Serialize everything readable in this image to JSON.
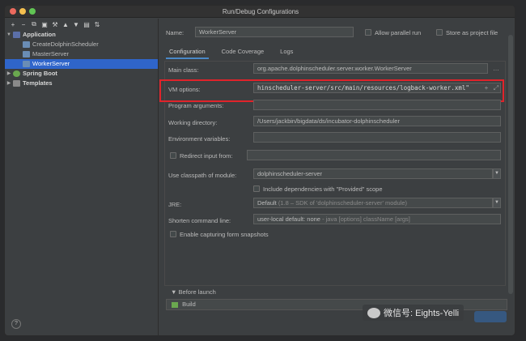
{
  "window": {
    "title": "Run/Debug Configurations"
  },
  "toolbar": {
    "icons": [
      "add-icon",
      "remove-icon",
      "copy-icon",
      "save-icon",
      "wrench-icon",
      "move-up-icon",
      "move-down-icon",
      "folder-icon",
      "sort-icon"
    ]
  },
  "tree": {
    "application": "Application",
    "children": [
      "CreateDolphinScheduler",
      "MasterServer",
      "WorkerServer"
    ],
    "spring_boot": "Spring Boot",
    "templates": "Templates"
  },
  "form": {
    "name_label": "Name:",
    "name_value": "WorkerServer",
    "parallel_label": "Allow parallel run",
    "store_label": "Store as project file",
    "tabs": [
      "Configuration",
      "Code Coverage",
      "Logs"
    ],
    "main_class_label": "Main class:",
    "main_class_value": "org.apache.dolphinscheduler.server.worker.WorkerServer",
    "vm_label": "VM options:",
    "vm_value": "hinscheduler-server/src/main/resources/logback-worker.xml\"",
    "program_args_label": "Program arguments:",
    "working_dir_label": "Working directory:",
    "working_dir_value": "/Users/jackbin/bigdata/ds/incubator-dolphinscheduler",
    "env_label": "Environment variables:",
    "redirect_label": "Redirect input from:",
    "classpath_label": "Use classpath of module:",
    "classpath_value": "dolphinscheduler-server",
    "provided_label": "Include dependencies with \"Provided\" scope",
    "jre_label": "JRE:",
    "jre_value": "Default",
    "jre_hint": "(1.8 – SDK of 'dolphinscheduler-server' module)",
    "shorten_label": "Shorten command line:",
    "shorten_value": "user-local default: none",
    "shorten_hint": "- java [options] className [args]",
    "snapshot_label": "Enable capturing form snapshots",
    "before_launch": "Before launch",
    "build": "Build"
  },
  "watermark": {
    "text": "微信号: Eights-Yelli"
  },
  "help": "?"
}
